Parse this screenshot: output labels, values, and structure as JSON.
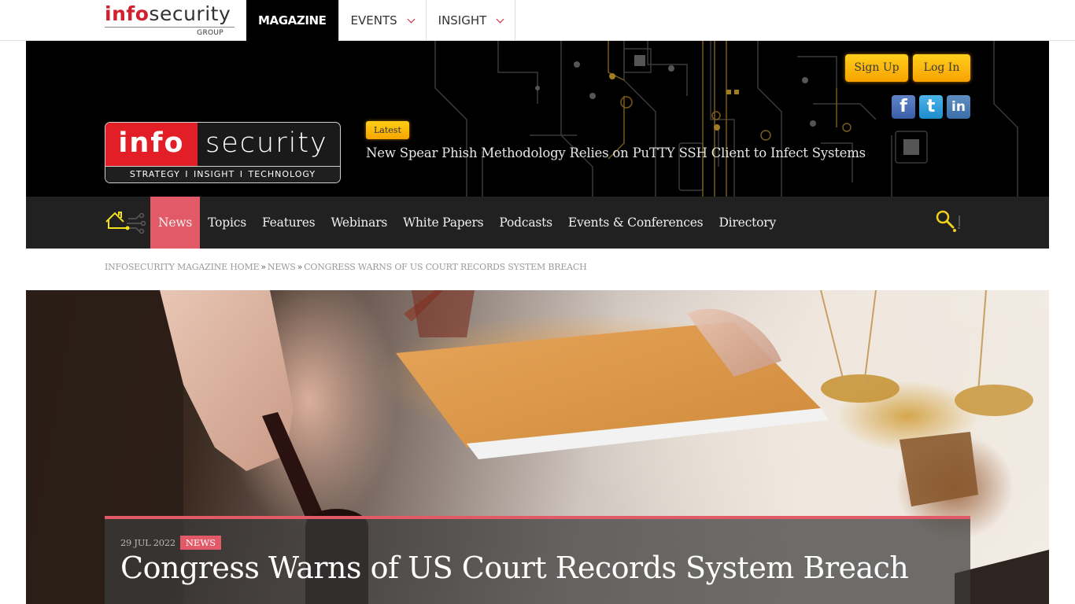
{
  "group_bar": {
    "logo": {
      "bold": "info",
      "regular": "security",
      "sub": "GROUP"
    },
    "nav": [
      {
        "label": "MAGAZINE",
        "active": true,
        "has_dropdown": false
      },
      {
        "label": "EVENTS",
        "active": false,
        "has_dropdown": true
      },
      {
        "label": "INSIGHT",
        "active": false,
        "has_dropdown": true
      }
    ]
  },
  "header": {
    "logo": {
      "bold": "info",
      "regular": "security",
      "tagline": "STRATEGY   I   INSIGHT   I   TECHNOLOGY"
    },
    "latest_badge": "Latest",
    "latest_headline": "New Spear Phish Methodology Relies on PuTTY SSH Client to Infect Systems",
    "auth": {
      "signup": "Sign Up",
      "login": "Log In"
    },
    "social": [
      {
        "name": "facebook",
        "glyph": "f"
      },
      {
        "name": "twitter",
        "glyph": "t"
      },
      {
        "name": "linkedin",
        "glyph": "in"
      }
    ]
  },
  "main_nav": {
    "home_icon": "home-circuit-icon",
    "items": [
      {
        "label": "News",
        "active": true
      },
      {
        "label": "Topics",
        "active": false
      },
      {
        "label": "Features",
        "active": false
      },
      {
        "label": "Webinars",
        "active": false
      },
      {
        "label": "White Papers",
        "active": false
      },
      {
        "label": "Podcasts",
        "active": false
      },
      {
        "label": "Events & Conferences",
        "active": false
      },
      {
        "label": "Directory",
        "active": false
      }
    ],
    "search_icon": "search-icon"
  },
  "breadcrumb": [
    {
      "label": "INFOSECURITY MAGAZINE HOME"
    },
    {
      "label": "NEWS"
    },
    {
      "label": "CONGRESS WARNS OF US COURT RECORDS SYSTEM BREACH"
    }
  ],
  "breadcrumb_sep": "»",
  "article": {
    "date": "29 JUL 2022",
    "category": "NEWS",
    "title": "Congress Warns of US Court Records System Breach",
    "hero_image": "gavel-scales-legal-documents"
  },
  "colors": {
    "brand_red": "#e21f26",
    "accent_pink": "#e25a67",
    "gold": "#f7a600",
    "nav_bg": "#212121"
  }
}
